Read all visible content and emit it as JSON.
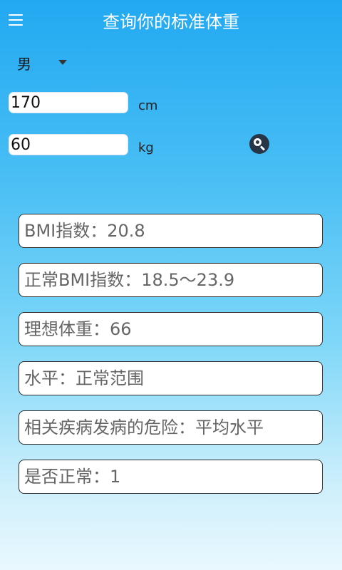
{
  "appbar": {
    "title": "查询你的标准体重",
    "menu_icon": "menu-icon"
  },
  "form": {
    "gender": "男",
    "height_value": "170",
    "height_unit": "cm",
    "weight_value": "60",
    "weight_unit": "kg",
    "search_icon": "search-icon"
  },
  "results": [
    "BMI指数：20.8",
    "正常BMI指数：18.5～23.9",
    "理想体重：66",
    "水平：正常范围",
    "相关疾病发病的危险：平均水平",
    "是否正常：1"
  ],
  "colors": {
    "appbar": "#22a9f2",
    "search_button": "#263647",
    "result_text": "#666666"
  }
}
